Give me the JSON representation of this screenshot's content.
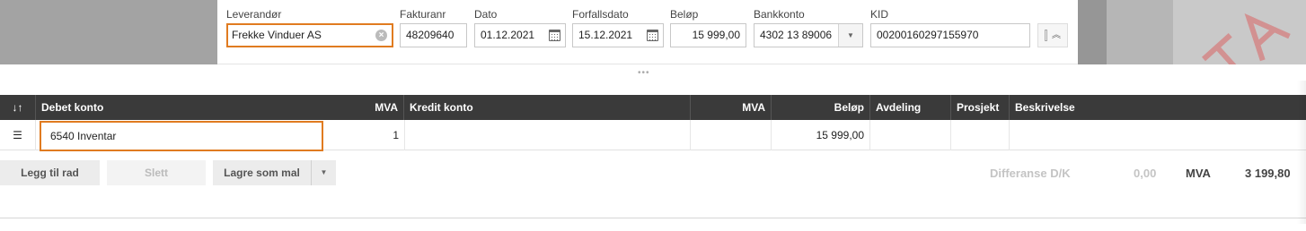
{
  "invoice": {
    "supplier": {
      "label": "Leverandør",
      "value": "Frekke Vinduer AS"
    },
    "invoice_no": {
      "label": "Fakturanr",
      "value": "48209640"
    },
    "date": {
      "label": "Dato",
      "value": "01.12.2021"
    },
    "due_date": {
      "label": "Forfallsdato",
      "value": "15.12.2021"
    },
    "amount": {
      "label": "Beløp",
      "value": "15 999,00"
    },
    "bank_account": {
      "label": "Bankkonto",
      "value": "4302 13 89006"
    },
    "kid": {
      "label": "KID",
      "value": "00200160297155970"
    }
  },
  "icons": {
    "clear": "clear-circle-icon",
    "calendar": "calendar-icon",
    "dropdown": "chevron-down-icon",
    "collapse": "chevron-up-icon",
    "sort": "sort-arrows-icon",
    "drag": "drag-handle-icon"
  },
  "grid": {
    "sort_glyph": "↓↑",
    "columns": {
      "debit_account": "Debet konto",
      "vat1": "MVA",
      "credit_account": "Kredit konto",
      "vat2": "MVA",
      "amount": "Beløp",
      "department": "Avdeling",
      "project": "Prosjekt",
      "description": "Beskrivelse"
    },
    "rows": [
      {
        "debit_account": "6540 Inventar",
        "vat1": "1",
        "credit_account": "",
        "vat2": "",
        "amount": "15 999,00",
        "department": "",
        "project": "",
        "description": ""
      }
    ]
  },
  "actions": {
    "add_row": "Legg til rad",
    "delete": "Slett",
    "save_template": "Lagre som mal"
  },
  "summary": {
    "difference_label": "Differanse D/K",
    "difference_value": "0,00",
    "vat_label": "MVA",
    "vat_value": "3 199,80"
  },
  "colors": {
    "focus_border": "#e07b20",
    "grid_header_bg": "#3a3a3a"
  }
}
